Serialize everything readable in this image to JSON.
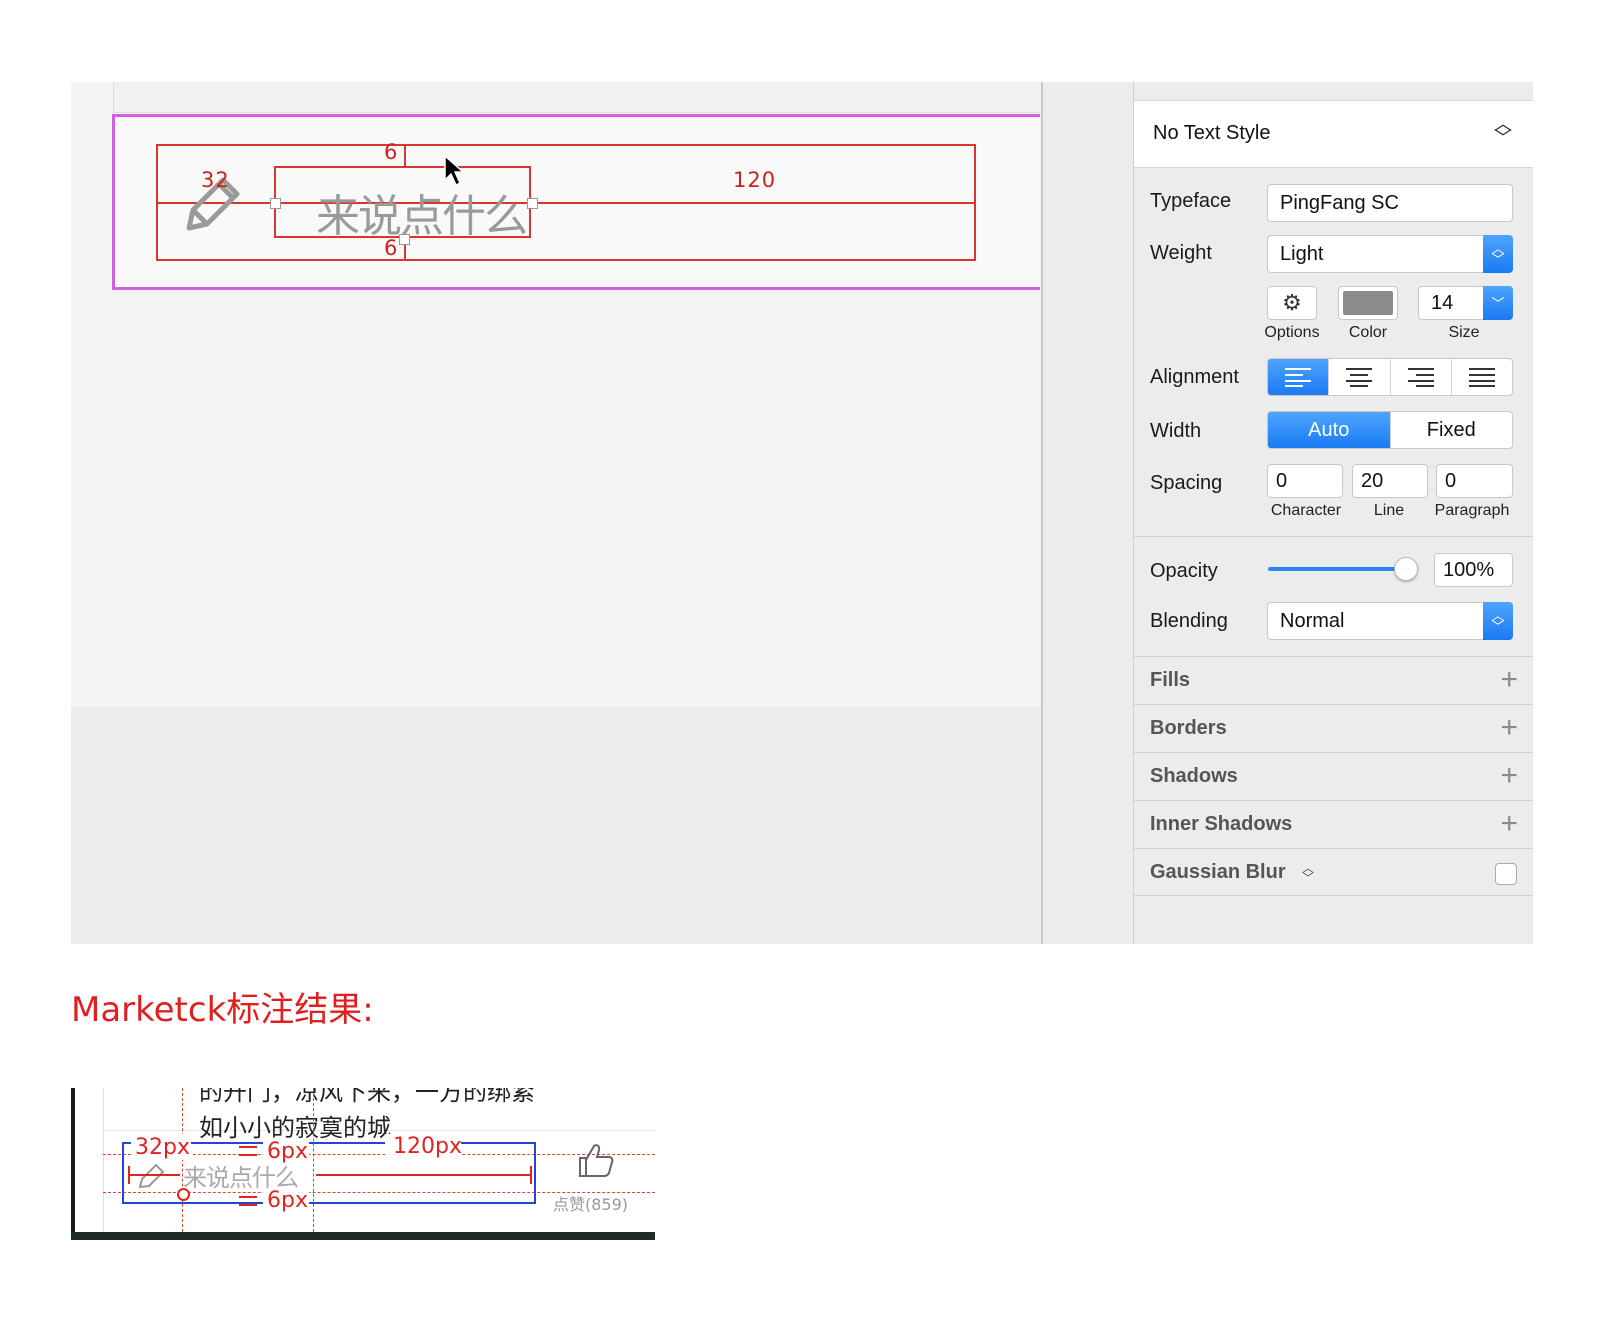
{
  "canvas": {
    "placeholder_text": "来说点什么",
    "measure_top": "6",
    "measure_bottom": "6",
    "measure_left": "32",
    "measure_right": "120"
  },
  "inspector": {
    "text_style": "No Text Style",
    "typeface_label": "Typeface",
    "typeface_value": "PingFang SC",
    "weight_label": "Weight",
    "weight_value": "Light",
    "options_label": "Options",
    "color_label": "Color",
    "size_label": "Size",
    "size_value": "14",
    "alignment_label": "Alignment",
    "alignment_selected": "left",
    "width_label": "Width",
    "width_options": [
      "Auto",
      "Fixed"
    ],
    "width_selected": "Auto",
    "spacing_label": "Spacing",
    "spacing_values": [
      "0",
      "20",
      "0"
    ],
    "spacing_sublabels": [
      "Character",
      "Line",
      "Paragraph"
    ],
    "opacity_label": "Opacity",
    "opacity_value": "100%",
    "opacity_fraction": 1.0,
    "blending_label": "Blending",
    "blending_value": "Normal",
    "sections": [
      "Fills",
      "Borders",
      "Shadows",
      "Inner Shadows",
      "Gaussian Blur"
    ],
    "accent_color": "#1a7af2",
    "text_color_swatch": "#8c8c8c"
  },
  "heading": "Marketck标注结果:",
  "marketch": {
    "text_line1": "的开门，凉风下来，一方的绑紧",
    "text_line2": "如小小的寂寞的城",
    "placeholder_text": "来说点什么",
    "label_left": "32px",
    "label_top": "6px",
    "label_bottom": "6px",
    "label_right": "120px",
    "like_count": "点赞(859)",
    "measure_color": "#e0251f",
    "box_color": "#2643d8"
  },
  "selection_color": "#d25fe0"
}
